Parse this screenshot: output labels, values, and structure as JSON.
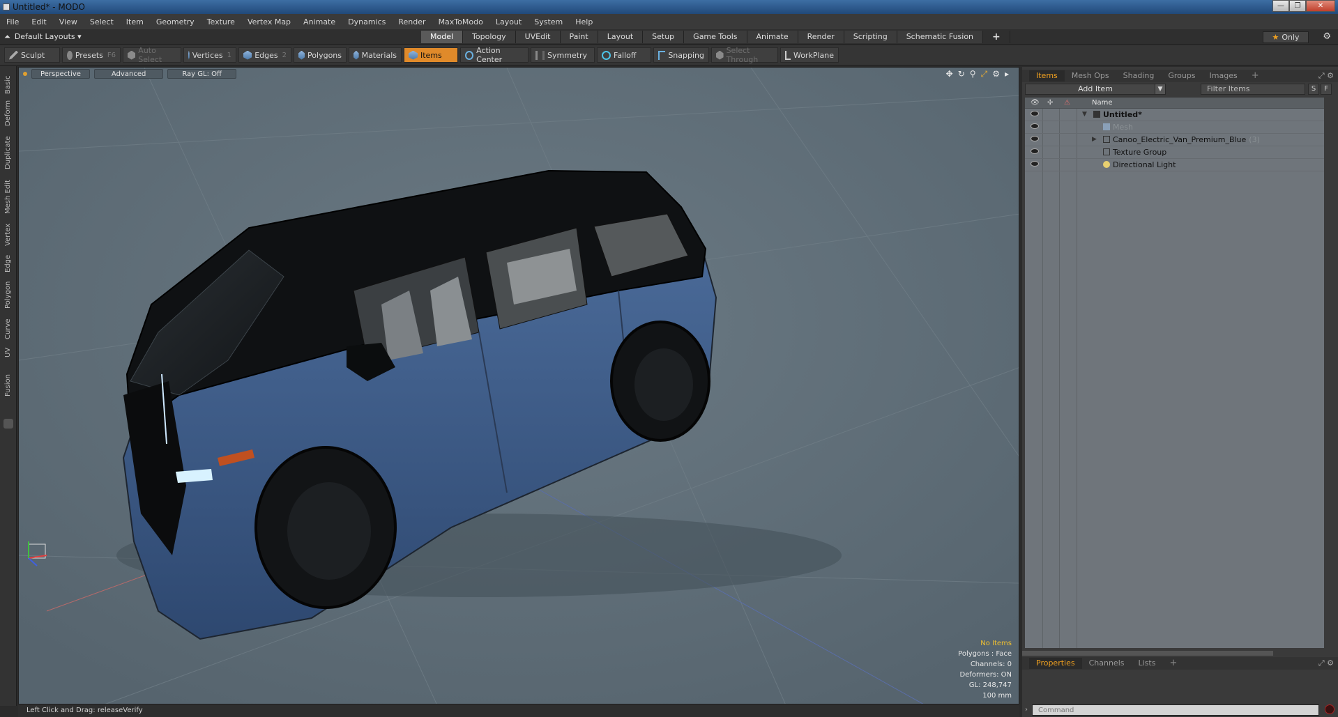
{
  "window": {
    "title": "Untitled* - MODO",
    "buttons": [
      "—",
      "❐",
      "✕"
    ]
  },
  "menu": [
    "File",
    "Edit",
    "View",
    "Select",
    "Item",
    "Geometry",
    "Texture",
    "Vertex Map",
    "Animate",
    "Dynamics",
    "Render",
    "MaxToModo",
    "Layout",
    "System",
    "Help"
  ],
  "layoutbar": {
    "layouts_label": "Default Layouts ▾",
    "tabs": [
      "Model",
      "Topology",
      "UVEdit",
      "Paint",
      "Layout",
      "Setup",
      "Game Tools",
      "Animate",
      "Render",
      "Scripting",
      "Schematic Fusion"
    ],
    "active_tab": "Model",
    "plus": "+",
    "only_label": "Only"
  },
  "toolbar": {
    "sculpt": "Sculpt",
    "presets": "Presets",
    "presets_key": "F6",
    "auto_select": "Auto Select",
    "vertices": "Vertices",
    "vertices_key": "1",
    "edges": "Edges",
    "edges_key": "2",
    "polygons": "Polygons",
    "materials": "Materials",
    "items": "Items",
    "action_center": "Action Center",
    "symmetry": "Symmetry",
    "falloff": "Falloff",
    "snapping": "Snapping",
    "select_through": "Select Through",
    "workplane": "WorkPlane"
  },
  "left_tabs": [
    "Basic",
    "Deform",
    "Duplicate",
    "Mesh Edit",
    "Vertex",
    "Edge",
    "Polygon",
    "Curve",
    "UV",
    "Fusion"
  ],
  "viewport": {
    "view_mode": "Perspective",
    "advanced": "Advanced",
    "raygl": "Ray GL: Off",
    "stats": {
      "items": "No Items",
      "polygons": "Polygons : Face",
      "channels": "Channels: 0",
      "deformers": "Deformers: ON",
      "gl": "GL: 248,747",
      "scale": "100 mm"
    },
    "body_color": "#3e5a85"
  },
  "status": {
    "text": "Left Click and Drag:   releaseVerify"
  },
  "items_panel": {
    "tabs": [
      "Items",
      "Mesh Ops",
      "Shading",
      "Groups",
      "Images"
    ],
    "active_tab": "Items",
    "add_item": "Add Item",
    "filter_placeholder": "Filter Items",
    "s_btn": "S",
    "f_btn": "F",
    "name_header": "Name",
    "rows": [
      {
        "label": "Untitled*",
        "count": ""
      },
      {
        "label": "Mesh",
        "count": ""
      },
      {
        "label": "Canoo_Electric_Van_Premium_Blue",
        "count": "(3)"
      },
      {
        "label": "Texture Group",
        "count": ""
      },
      {
        "label": "Directional Light",
        "count": ""
      }
    ]
  },
  "properties_panel": {
    "tabs": [
      "Properties",
      "Channels",
      "Lists"
    ],
    "active_tab": "Properties",
    "command_placeholder": "Command"
  }
}
